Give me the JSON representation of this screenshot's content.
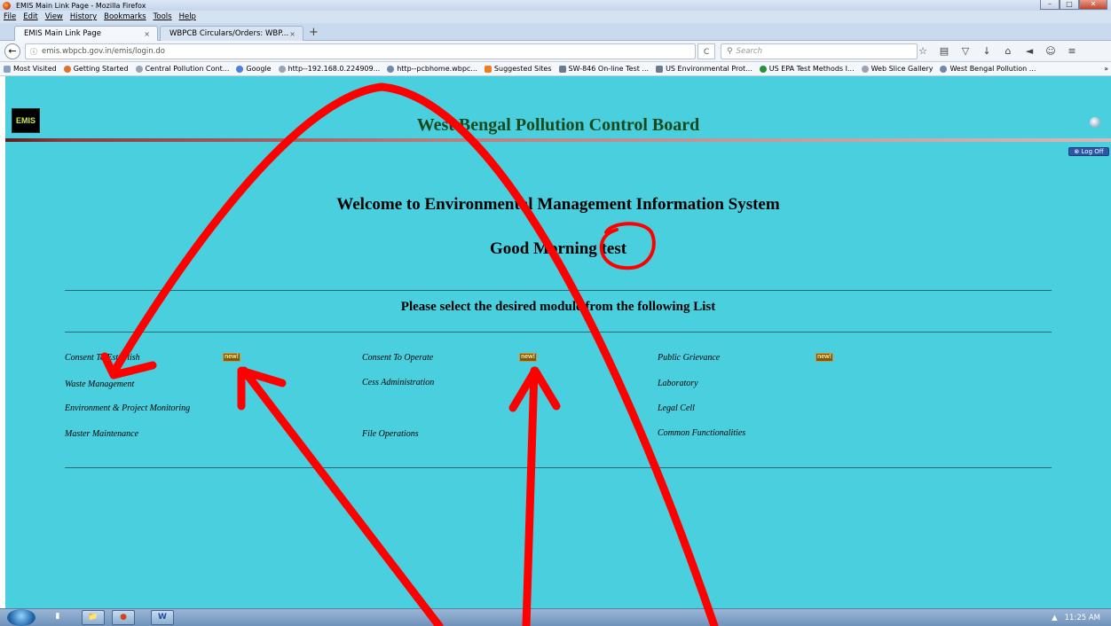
{
  "window": {
    "title": "EMIS Main Link Page - Mozilla Firefox",
    "min": "–",
    "max": "□",
    "close": "✕"
  },
  "menu": [
    "File",
    "Edit",
    "View",
    "History",
    "Bookmarks",
    "Tools",
    "Help"
  ],
  "tabs": [
    {
      "label": "EMIS Main Link Page",
      "close": "×"
    },
    {
      "label": "WBPCB Circulars/Orders: WBP...",
      "close": "×"
    }
  ],
  "newtab": "+",
  "nav": {
    "back": "←",
    "info": "ⓘ",
    "url": "emis.wbpcb.gov.in/emis/login.do",
    "reload": "C",
    "search_placeholder": "Search",
    "search_icon": "🔍"
  },
  "nav_icons": [
    "☆",
    "▤",
    "▽",
    "↓",
    "⌂",
    "◄",
    "☺",
    "≡"
  ],
  "bookmarks": [
    "Most Visited",
    "Getting Started",
    "Central Pollution Cont...",
    "Google",
    "http--192.168.0.224909...",
    "http--pcbhome.wbpc...",
    "Suggested Sites",
    "SW-846 On-line Test ...",
    "US Environmental Prot...",
    "US EPA Test Methods I...",
    "Web Slice Gallery",
    "West Bengal Pollution ..."
  ],
  "bookmarks_more": "»",
  "page": {
    "logo_text": "EMIS",
    "header_title": "West Bengal Pollution Control Board",
    "logoff": "Log Off",
    "welcome": "Welcome to Environmental Management Information System",
    "greeting": "Good Morning test",
    "select_text": "Please select the desired module from the following List",
    "badge": "new!",
    "modules": {
      "col1": [
        "Consent To Establish",
        "Waste Management",
        "Environment & Project Monitoring",
        "Master Maintenance"
      ],
      "col2": [
        "Consent To Operate",
        "Cess Administration",
        "File Operations"
      ],
      "col3": [
        "Public Grievance",
        "Laboratory",
        "Legal Cell",
        "Common Functionalities"
      ]
    }
  },
  "taskbar": {
    "time": "11:25 AM",
    "tray_arrow": "▲",
    "apps": [
      "▮",
      "📁",
      "●",
      "W"
    ]
  },
  "colors": {
    "page_bg": "#4acfde",
    "header_title": "#174a1c",
    "annotation": "#ff0000"
  }
}
